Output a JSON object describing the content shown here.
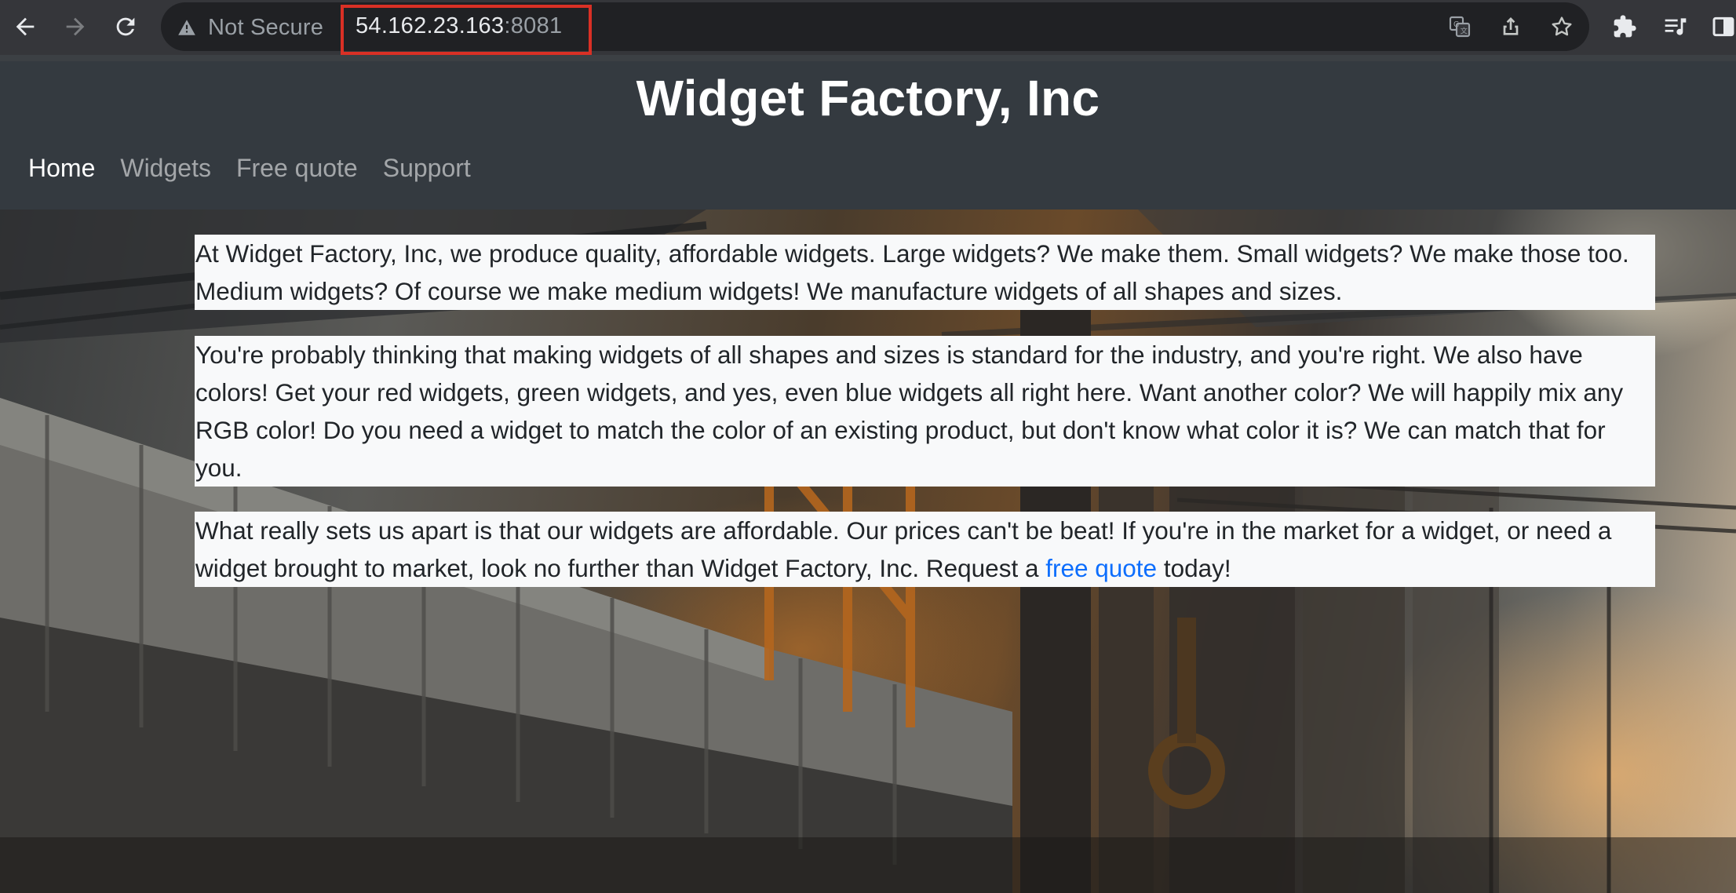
{
  "browser": {
    "security_label": "Not Secure",
    "url_host": "54.162.23.163",
    "url_port": ":8081",
    "icons": [
      "back-icon",
      "forward-icon",
      "reload-icon",
      "warning-icon",
      "translate-icon",
      "share-icon",
      "star-icon",
      "extensions-icon",
      "reading-list-icon",
      "side-panel-icon"
    ]
  },
  "site": {
    "title": "Widget Factory, Inc",
    "nav": {
      "home": "Home",
      "widgets": "Widgets",
      "free_quote": "Free quote",
      "support": "Support"
    }
  },
  "content": {
    "p1": "At Widget Factory, Inc, we produce quality, affordable widgets. Large widgets? We make them. Small widgets? We make those too. Medium widgets? Of course we make medium widgets! We manufacture widgets of all shapes and sizes.",
    "p2": "You're probably thinking that making widgets of all shapes and sizes is standard for the industry, and you're right. We also have colors! Get your red widgets, green widgets, and yes, even blue widgets all right here. Want another color? We will happily mix any RGB color! Do you need a widget to match the color of an existing product, but don't know what color it is? We can match that for you.",
    "p3_before": "What really sets us apart is that our widgets are affordable. Our prices can't be beat! If you're in the market for a widget, or need a widget brought to market, look no further than Widget Factory, Inc. Request a ",
    "p3_link": "free quote",
    "p3_after": " today!"
  },
  "colors": {
    "chrome_bg": "#35363a",
    "header_bg": "#343a40",
    "highlight_box": "#d93025",
    "link": "#0d6efd"
  }
}
